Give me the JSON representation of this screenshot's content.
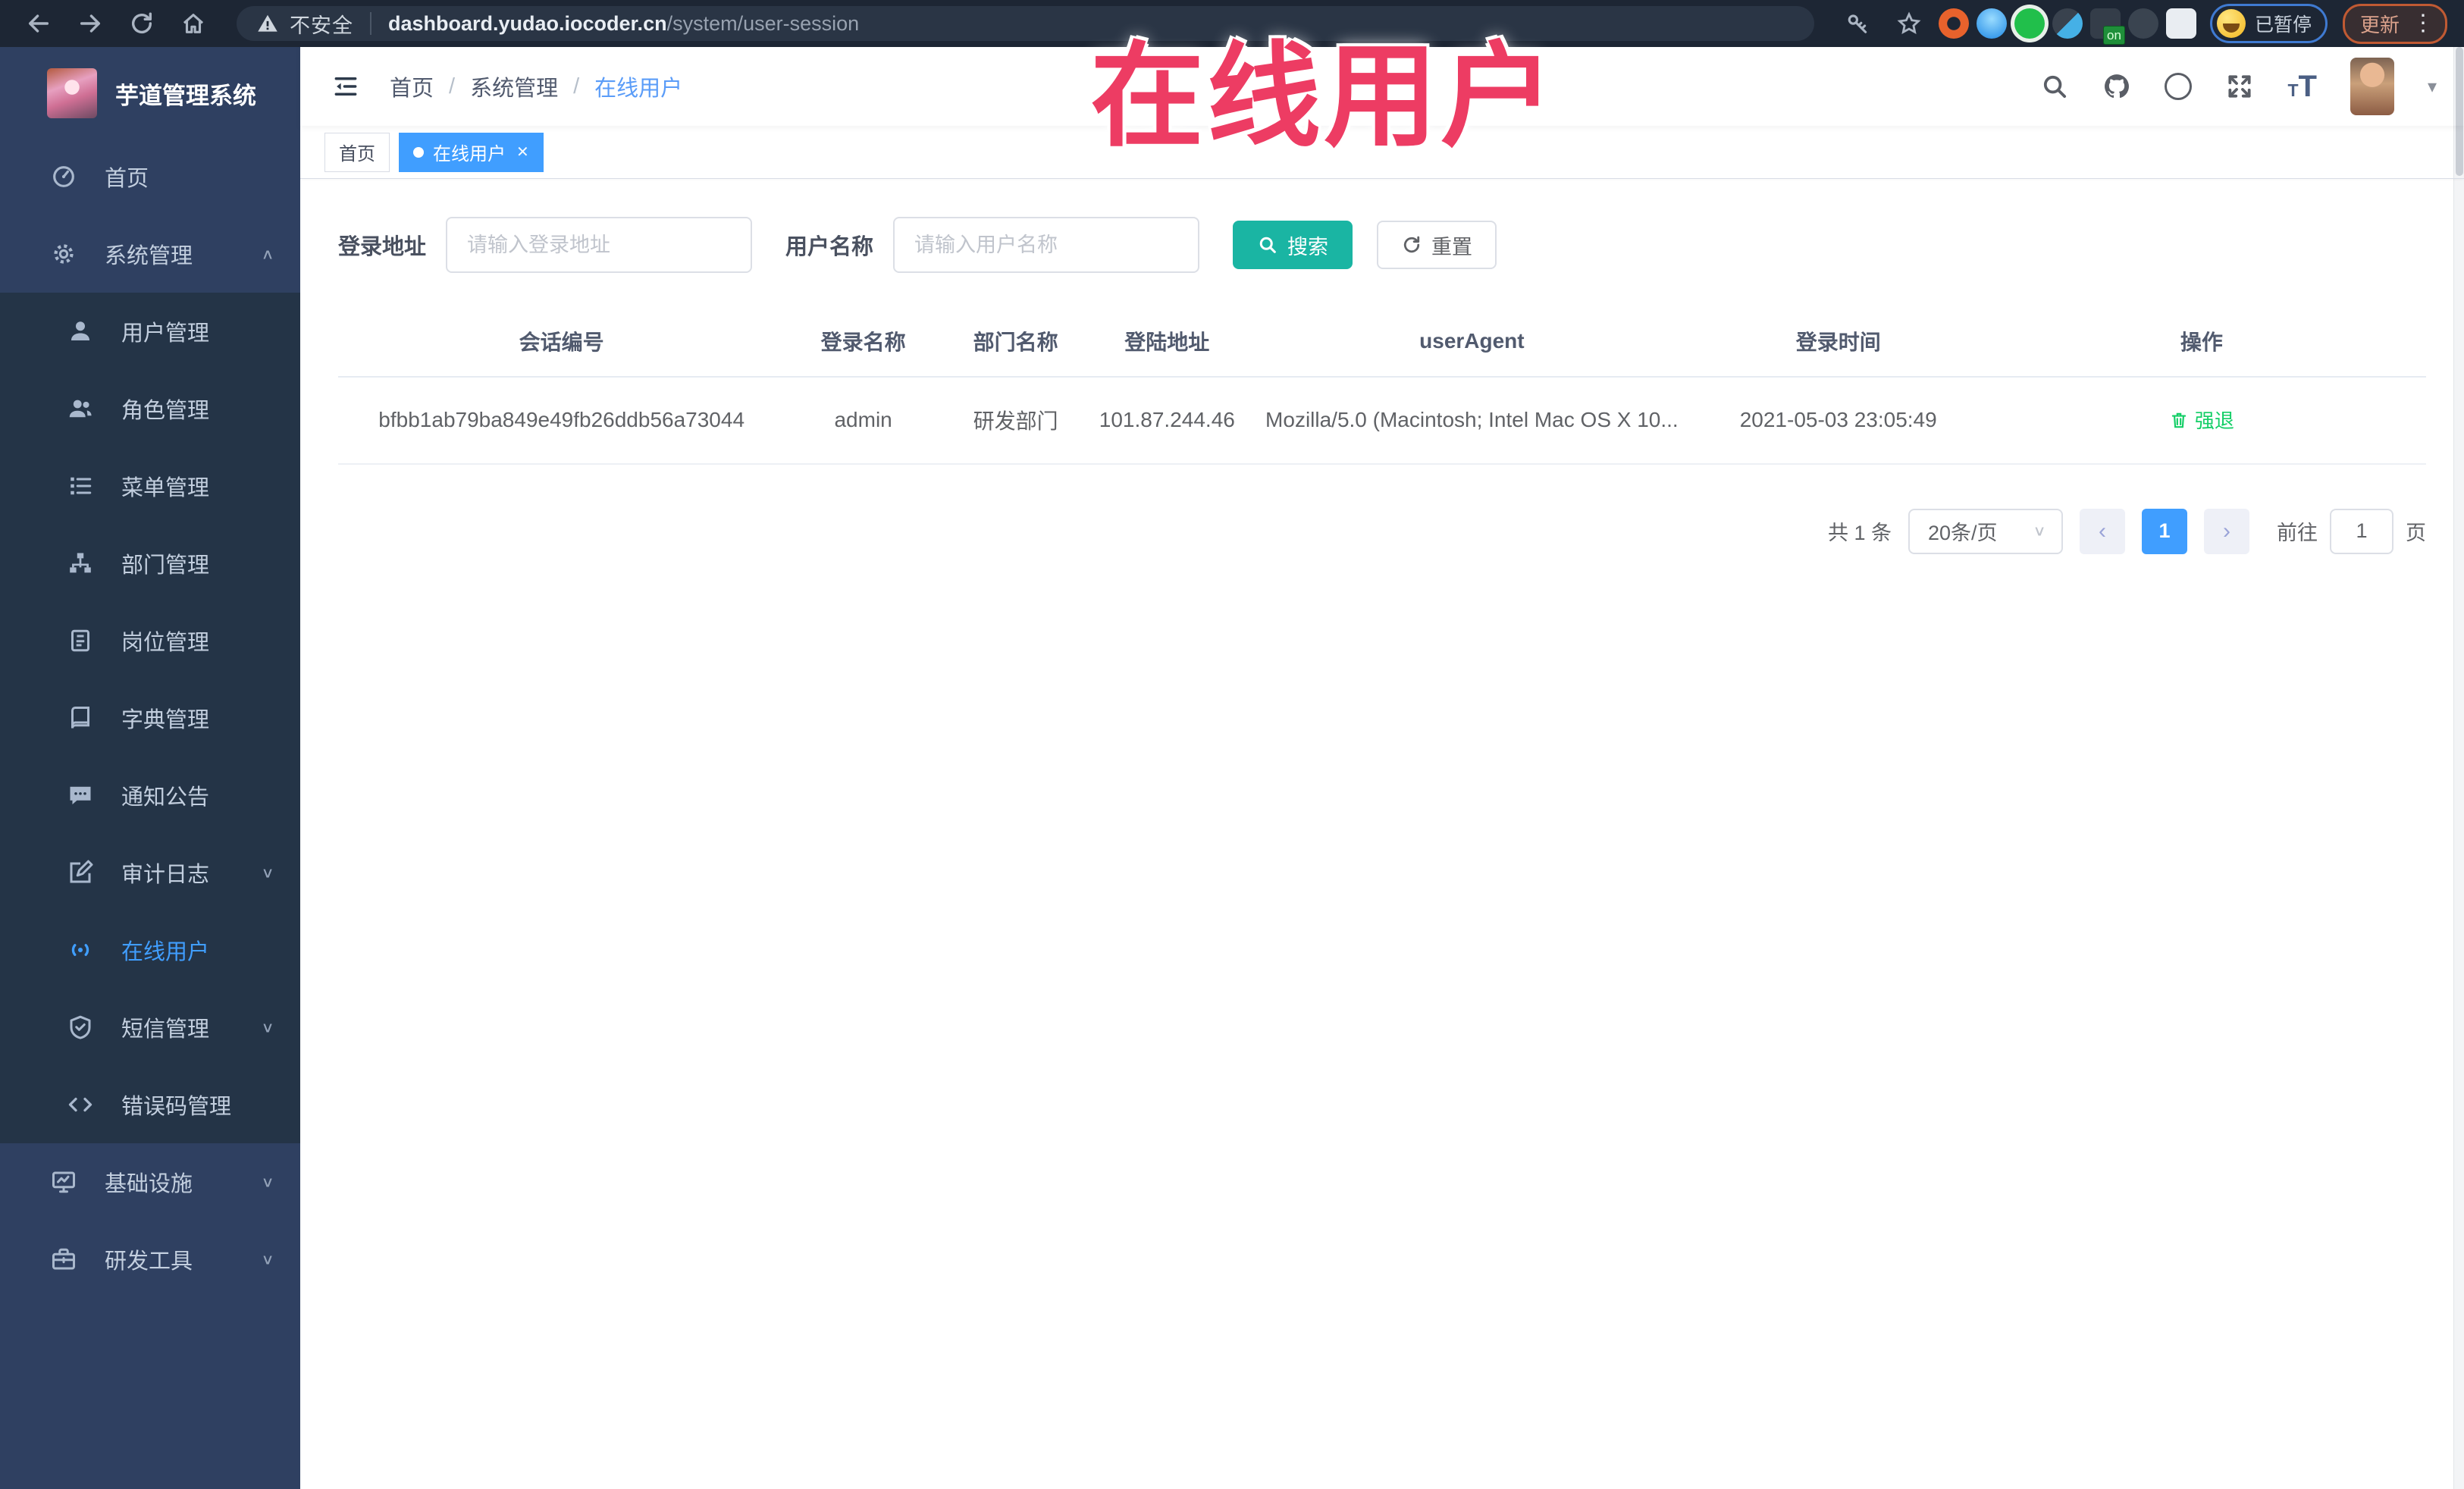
{
  "colors": {
    "accent": "#409eff",
    "sidebar_bg": "#2f4061",
    "submenu_bg": "#243447",
    "search_button": "#1ab5a3",
    "success_green": "#13ce66",
    "overlay_red": "#ed3c63",
    "chrome_bg": "#1d2634"
  },
  "icons": {
    "close": "✕",
    "chevron_down": "∨",
    "chevron_up": "∧",
    "kebab": "⋮",
    "caret_down": "▾",
    "prev": "‹",
    "next": "›",
    "separator": "/"
  },
  "browser": {
    "security_label": "不安全",
    "url_domain": "dashboard.yudao.iocoder.cn",
    "url_path": "/system/user-session",
    "on_badge": "on",
    "paused_badge": "已暂停",
    "update_label": "更新"
  },
  "overlay": {
    "text": "在线用户"
  },
  "sidebar": {
    "title": "芋道管理系统",
    "home": {
      "label": "首页"
    },
    "system": {
      "label": "系统管理"
    },
    "system_children": [
      {
        "label": "用户管理"
      },
      {
        "label": "角色管理"
      },
      {
        "label": "菜单管理"
      },
      {
        "label": "部门管理"
      },
      {
        "label": "岗位管理"
      },
      {
        "label": "字典管理"
      },
      {
        "label": "通知公告"
      },
      {
        "label": "审计日志"
      },
      {
        "label": "在线用户"
      },
      {
        "label": "短信管理"
      },
      {
        "label": "错误码管理"
      }
    ],
    "infra": {
      "label": "基础设施"
    },
    "devtools": {
      "label": "研发工具"
    }
  },
  "header": {
    "breadcrumb": [
      "首页",
      "系统管理",
      "在线用户"
    ]
  },
  "tags": {
    "home": "首页",
    "online": "在线用户"
  },
  "filters": {
    "login_address_label": "登录地址",
    "login_address_placeholder": "请输入登录地址",
    "username_label": "用户名称",
    "username_placeholder": "请输入用户名称",
    "search_button": "搜索",
    "reset_button": "重置"
  },
  "table": {
    "headers": [
      "会话编号",
      "登录名称",
      "部门名称",
      "登陆地址",
      "userAgent",
      "登录时间",
      "操作"
    ],
    "rows": [
      {
        "session_id": "bfbb1ab79ba849e49fb26ddb56a73044",
        "username": "admin",
        "dept": "研发部门",
        "ip": "101.87.244.46",
        "user_agent": "Mozilla/5.0 (Macintosh; Intel Mac OS X 10...",
        "login_time": "2021-05-03 23:05:49",
        "action": "强退"
      }
    ]
  },
  "pagination": {
    "total_text": "共 1 条",
    "page_size": "20条/页",
    "current_page": "1",
    "goto_label": "前往",
    "goto_value": "1",
    "page_unit": "页"
  }
}
